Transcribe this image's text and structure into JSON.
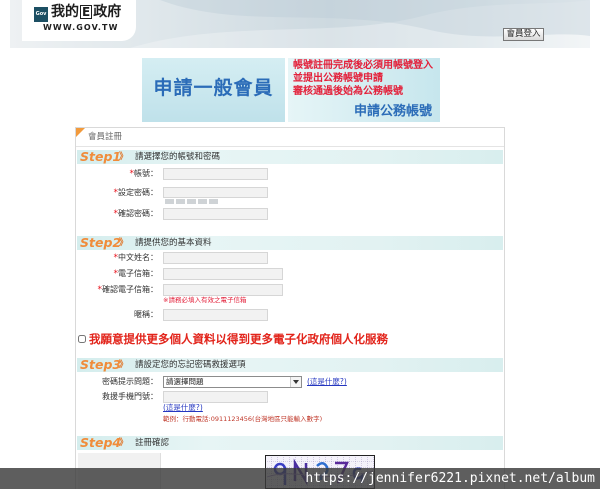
{
  "colors": {
    "required_red": "#e8141e",
    "notice_red": "#e3203a",
    "optin_red": "#e2241b",
    "step_orange": "#f08c3a",
    "link_blue": "#2436c0",
    "banner_blue": "#2b6cb8"
  },
  "icons": {
    "logo": "gov-logo-icon",
    "corner": "orange-corner-triangle-icon",
    "select": "chevron-down-icon"
  },
  "header": {
    "logo_icon_text": "Gov",
    "logo_title": [
      "我的",
      "E",
      "政府"
    ],
    "logo_url": "WWW.GOV.TW",
    "login_button": "會員登入"
  },
  "banner": {
    "general_member": "申請一般會員",
    "notice_lines": [
      "帳號註冊完成後必須用帳號登入",
      "並提出公務帳號申請",
      "審核通過後始為公務帳號"
    ],
    "official_account": "申請公務帳號"
  },
  "form": {
    "title": "會員註冊",
    "required_mark": "*",
    "step1": {
      "step_label": "Step1",
      "marker": "》",
      "heading": "請選擇您的帳號和密碼",
      "account": {
        "label": "帳號：",
        "value": ""
      },
      "password": {
        "label": "設定密碼：",
        "value": "",
        "strength_segments": 5,
        "strength_level": 0
      },
      "password_confirm": {
        "label": "確認密碼：",
        "value": ""
      }
    },
    "step2": {
      "step_label": "Step2",
      "marker": "》",
      "heading": "請提供您的基本資料",
      "chinese_name": {
        "label": "中文姓名：",
        "value": ""
      },
      "email": {
        "label": "電子信箱：",
        "value": ""
      },
      "email_confirm": {
        "label": "確認電子信箱：",
        "value": ""
      },
      "email_note": "※請務必填入有效之電子信箱",
      "nickname": {
        "label": "暱稱：",
        "value": ""
      }
    },
    "optin": {
      "label": "我願意提供更多個人資料以得到更多電子化政府個人化服務",
      "checked": false
    },
    "step3": {
      "step_label": "Step3",
      "marker": "》",
      "heading": "請設定您的忘記密碼救援選項",
      "question": {
        "label": "密碼提示問題：",
        "selected": "請選擇問題",
        "help_link": "(這是什麼?)"
      },
      "phone": {
        "label": "救援手機門號：",
        "value": "",
        "help_link": "(這是什麼?)",
        "example": "範例：行動電話:0911123456(台灣地區只能輸入數字)"
      }
    },
    "step4": {
      "step_label": "Step4",
      "marker": "》",
      "heading": "註冊確認"
    }
  },
  "watermark": "https://jennifer6221.pixnet.net/album"
}
